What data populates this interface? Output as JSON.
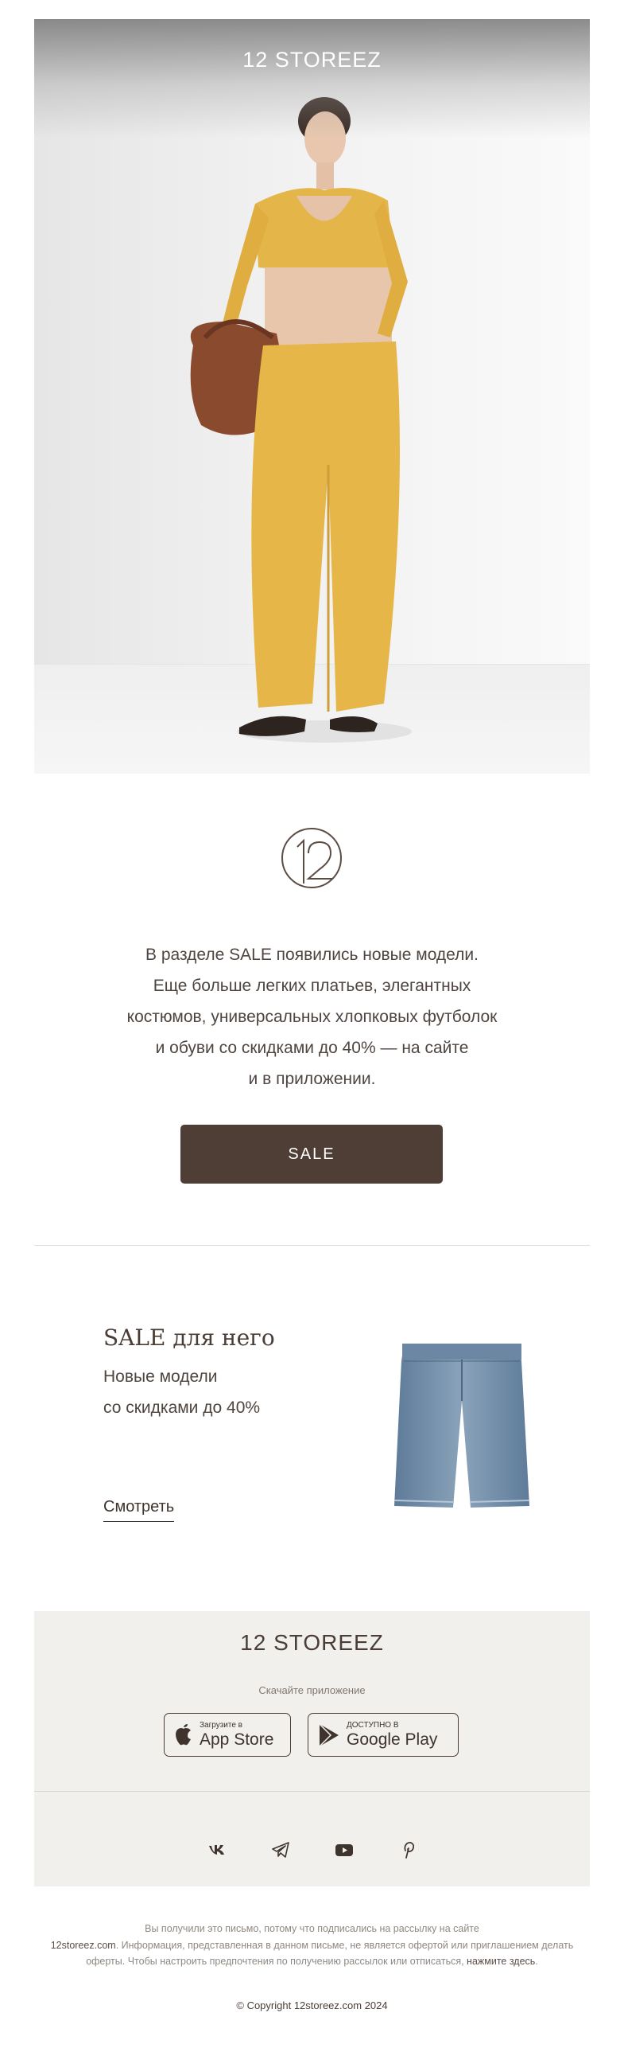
{
  "hero": {
    "brand": "12 STOREEZ"
  },
  "intro": {
    "lines": [
      "В разделе SALE появились новые модели.",
      "Еще больше легких платьев, элегантных",
      "костюмов, универсальных хлопковых футболок",
      "и обуви со скидками до 40% — на сайте",
      "и в приложении."
    ]
  },
  "sale_button": "SALE",
  "promo": {
    "title": "SALE для него",
    "subtitle_line1": "Новые модели",
    "subtitle_line2": "со скидками до 40%",
    "link": "Смотреть"
  },
  "footer": {
    "brand": "12 STOREEZ",
    "download_text": "Скачайте приложение",
    "appstore_small": "Загрузите в",
    "appstore_big": "App Store",
    "gplay_small": "ДОСТУПНО В",
    "gplay_big": "Google Play",
    "social": [
      "vk-icon",
      "telegram-icon",
      "youtube-icon",
      "pinterest-icon"
    ]
  },
  "legal": {
    "part1": "Вы получили это письмо, потому что подписались на рассылку на сайте",
    "site_link": "12storeez.com",
    "part2": ". Информация, представленная в данном письме, не является офертой или приглашением делать оферты. Чтобы настроить предпочтения по получению рассылок или отписаться, ",
    "click_here": "нажмите здесь",
    "end": ".",
    "copyright": "© Copyright 12storeez.com 2024"
  },
  "colors": {
    "accent_button": "#4f3e35",
    "text": "#4a3d36",
    "footer_bg": "#f1f0ec"
  }
}
